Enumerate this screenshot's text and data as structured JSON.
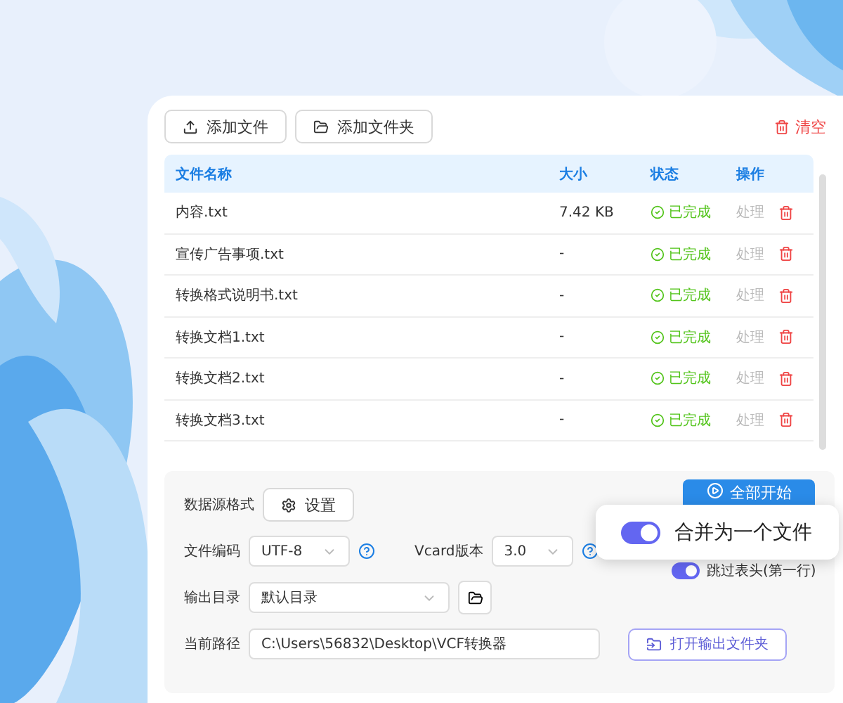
{
  "toolbar": {
    "add_file": "添加文件",
    "add_folder": "添加文件夹",
    "clear": "清空"
  },
  "table": {
    "columns": [
      "文件名称",
      "大小",
      "状态",
      "操作"
    ],
    "rows": [
      {
        "name": "内容.txt",
        "size": "7.42 KB",
        "status": "已完成",
        "action": "处理",
        "action_disabled": true
      },
      {
        "name": "宣传广告事项.txt",
        "size": "-",
        "status": "已完成",
        "action": "处理",
        "action_disabled": true
      },
      {
        "name": "转换格式说明书.txt",
        "size": "-",
        "status": "已完成",
        "action": "处理",
        "action_disabled": true
      },
      {
        "name": "转换文档1.txt",
        "size": "-",
        "status": "已完成",
        "action": "处理",
        "action_disabled": true
      },
      {
        "name": "转换文档2.txt",
        "size": "-",
        "status": "已完成",
        "action": "处理",
        "action_disabled": true
      },
      {
        "name": "转换文档3.txt",
        "size": "-",
        "status": "已完成",
        "action": "处理",
        "action_disabled": true
      }
    ]
  },
  "settings": {
    "source_format_label": "数据源格式",
    "settings_button": "设置",
    "start_button": "全部开始",
    "encoding_label": "文件编码",
    "encoding_value": "UTF-8",
    "vcard_label": "Vcard版本",
    "vcard_value": "3.0",
    "skip_header": {
      "label": "跳过表头(第一行)",
      "on": true
    },
    "output_label": "输出目录",
    "output_value": "默认目录",
    "path_label": "当前路径",
    "path_value": "C:\\Users\\56832\\Desktop\\VCF转换器",
    "open_folder_button": "打开输出文件夹"
  },
  "popup": {
    "label": "合并为一个文件",
    "on": true
  }
}
